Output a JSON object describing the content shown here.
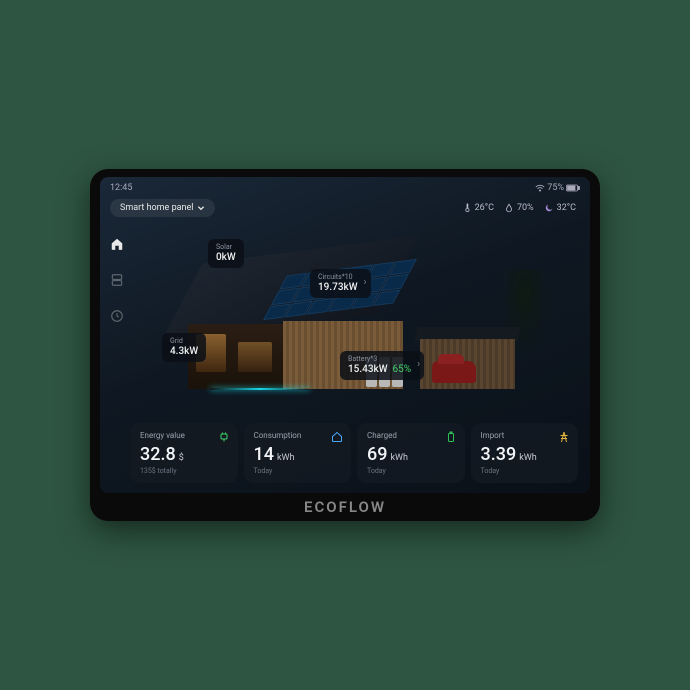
{
  "brand": "ECOFLOW",
  "statusbar": {
    "time": "12:45",
    "wifi_label": "wifi",
    "battery_pct": "75%"
  },
  "panel_selector": {
    "label": "Smart home panel"
  },
  "weather": {
    "temp_inside": "26°C",
    "humidity": "70%",
    "temp_outside": "32°C"
  },
  "scene": {
    "solar": {
      "title": "Solar",
      "value": "0kW"
    },
    "circuits": {
      "title": "Circuits*10",
      "value": "19.73kW"
    },
    "grid": {
      "title": "Grid",
      "value": "4.3kW"
    },
    "battery": {
      "title": "Battery*3",
      "value": "15.43kW",
      "pct": "65%"
    }
  },
  "cards": [
    {
      "title": "Energy value",
      "value": "32.8",
      "unit": "$",
      "sub": "135$ totally",
      "icon": "plug",
      "icon_color": "ic-green"
    },
    {
      "title": "Consumption",
      "value": "14",
      "unit": "kWh",
      "sub": "Today",
      "icon": "home",
      "icon_color": "ic-blue"
    },
    {
      "title": "Charged",
      "value": "69",
      "unit": "kWh",
      "sub": "Today",
      "icon": "battery",
      "icon_color": "ic-green2"
    },
    {
      "title": "Import",
      "value": "3.39",
      "unit": "kWh",
      "sub": "Today",
      "icon": "pylon",
      "icon_color": "ic-yellow"
    }
  ]
}
